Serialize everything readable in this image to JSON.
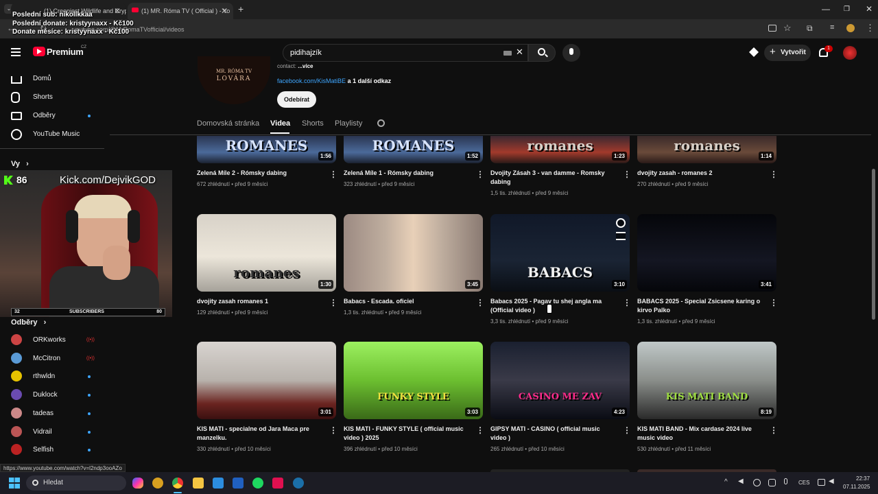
{
  "browser": {
    "tabs": [
      {
        "label": "(1) Creepiest Wildlife and Crypt"
      },
      {
        "label": "(1) MR. Róma TV ( Official ) - Yo"
      }
    ],
    "url": "youtube.com/@MrRomaTVofficial/videos",
    "status_url": "https://www.youtube.com/watch?v=l2ndp3ooAZo"
  },
  "overlay": {
    "last_sub": "Poslední sub: nikollkkaa",
    "last_donate": "Poslední donate: kristyynaxx - Kč100",
    "month_donate": "Donate měsíce: kristyynaxx - Kč100",
    "kick_count": "86",
    "kick_url": "Kick.com/DejvikGOD",
    "subs_left": "32",
    "subs_label": "SUBSCRIBERS",
    "subs_right": "80"
  },
  "header": {
    "logo": "Premium",
    "logo_region": "CZ",
    "search_value": "pidihajzík",
    "create_label": "Vytvořit",
    "notif_count": "1"
  },
  "sidebar": {
    "main": [
      {
        "label": "Domů",
        "icon": "home-icon"
      },
      {
        "label": "Shorts",
        "icon": "shorts-icon"
      },
      {
        "label": "Odběry",
        "icon": "subscriptions-icon"
      },
      {
        "label": "YouTube Music",
        "icon": "music-icon"
      }
    ],
    "you_label": "Vy",
    "subs_label": "Odběry",
    "channels": [
      {
        "name": "ORKworks",
        "live": true,
        "color": "#c44"
      },
      {
        "name": "McCitron",
        "live": true,
        "color": "#5a9ad6"
      },
      {
        "name": "rthwldn",
        "live": false,
        "color": "#e6c200"
      },
      {
        "name": "Duklock",
        "live": false,
        "color": "#6a4bb0"
      },
      {
        "name": "tadeas",
        "live": false,
        "color": "#c88"
      },
      {
        "name": "Vidrail",
        "live": false,
        "color": "#b55"
      },
      {
        "name": "Selfish",
        "live": false,
        "color": "#b22"
      }
    ]
  },
  "channel": {
    "contact": "contact:",
    "more": "...více",
    "link": "facebook.com/KisMatiBE",
    "link_more": "a 1 další odkaz",
    "subscribe": "Odebírat",
    "logo_line1": "MR. RÓMA TV",
    "logo_line2": "LOVÁRA",
    "tabs": [
      "Domovská stránka",
      "Videa",
      "Shorts",
      "Playlisty"
    ],
    "active_tab": "Videa"
  },
  "videos": [
    {
      "title": "Zelená Míle 2 - Rómsky dabing",
      "views": "672 zhlédnutí",
      "age": "před 9 měsíci",
      "duration": "1:56",
      "thumb_text": "ROMANES"
    },
    {
      "title": "Zelená Míle 1 - Rómsky dabing",
      "views": "323 zhlédnutí",
      "age": "před 9 měsíci",
      "duration": "1:52",
      "thumb_text": "ROMANES"
    },
    {
      "title": "Dvojity Zásah 3 - van damme - Romsky dabing",
      "views": "1,5 tis. zhlédnutí",
      "age": "před 9 měsíci",
      "duration": "1:23",
      "thumb_text": "romanes"
    },
    {
      "title": "dvojity zasah - romanes 2",
      "views": "270 zhlédnutí",
      "age": "před 9 měsíci",
      "duration": "1:14",
      "thumb_text": "romanes"
    },
    {
      "title": "dvojity zasah romanes 1",
      "views": "129 zhlédnutí",
      "age": "před 9 měsíci",
      "duration": "1:30",
      "thumb_text": "romanes"
    },
    {
      "title": "Babacs - Escada. oficiel",
      "views": "1,3 tis. zhlédnutí",
      "age": "před 9 měsíci",
      "duration": "3:45",
      "thumb_text": ""
    },
    {
      "title": "Babacs 2025 - Pagav tu shej angla ma (Official video )",
      "views": "3,3 tis. zhlédnutí",
      "age": "před 9 měsíci",
      "duration": "3:10",
      "thumb_text": "BABACS"
    },
    {
      "title": "BABACS 2025 - Special Zsicsene karing o kirvo Palko",
      "views": "1,3 tis. zhlédnutí",
      "age": "před 9 měsíci",
      "duration": "3:41",
      "thumb_text": ""
    },
    {
      "title": "KIS MATI - specialne od Jara Maca pre manzelku.",
      "views": "330 zhlédnutí",
      "age": "před 10 měsíci",
      "duration": "3:01",
      "thumb_text": ""
    },
    {
      "title": "KIS MATI - FUNKY STYLE ( official music video ) 2025",
      "views": "396 zhlédnutí",
      "age": "před 10 měsíci",
      "duration": "3:03",
      "thumb_text": "FUNKY STYLE"
    },
    {
      "title": "GIPSY MATI - CASINO ( official music video )",
      "views": "265 zhlédnutí",
      "age": "před 10 měsíci",
      "duration": "4:23",
      "thumb_text": "CASINO ME ZAV"
    },
    {
      "title": "KIS MATI BAND - Mix cardase 2024 live music video",
      "views": "530 zhlédnutí",
      "age": "před 11 měsíci",
      "duration": "8:19",
      "thumb_text": "KIS MATI BAND"
    }
  ],
  "taskbar": {
    "search_placeholder": "Hledat",
    "lang": "CES",
    "time": "22:37",
    "date": "07.11.2025"
  },
  "colors": {
    "youtube_red": "#ff0033",
    "link_blue": "#3ea6ff",
    "kick_green": "#53fc18"
  }
}
